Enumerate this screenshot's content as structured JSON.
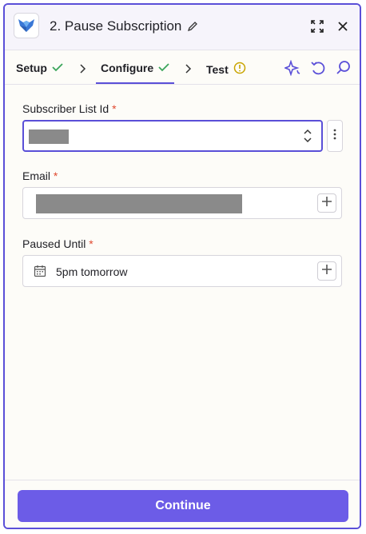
{
  "header": {
    "title": "2. Pause Subscription"
  },
  "tabs": [
    {
      "label": "Setup",
      "status": "complete"
    },
    {
      "label": "Configure",
      "status": "complete",
      "active": true
    },
    {
      "label": "Test",
      "status": "warning"
    }
  ],
  "fields": {
    "subscriber_list": {
      "label": "Subscriber List Id",
      "required_mark": "*"
    },
    "email": {
      "label": "Email",
      "required_mark": "*"
    },
    "paused_until": {
      "label": "Paused Until",
      "required_mark": "*",
      "value": "5pm tomorrow"
    }
  },
  "footer": {
    "continue_label": "Continue"
  },
  "colors": {
    "accent": "#5a4fd8",
    "button": "#6c5ce7",
    "success": "#3aa55a",
    "warning": "#c9a400",
    "required": "#e0492f"
  },
  "icons": [
    "app-logo-icon",
    "pencil-icon",
    "expand-icon",
    "close-icon",
    "check-icon",
    "chevron-right-icon",
    "warning-circle-icon",
    "sparkle-icon",
    "undo-icon",
    "search-icon",
    "calendar-icon",
    "plus-icon",
    "more-vertical-icon",
    "select-arrows-icon"
  ]
}
